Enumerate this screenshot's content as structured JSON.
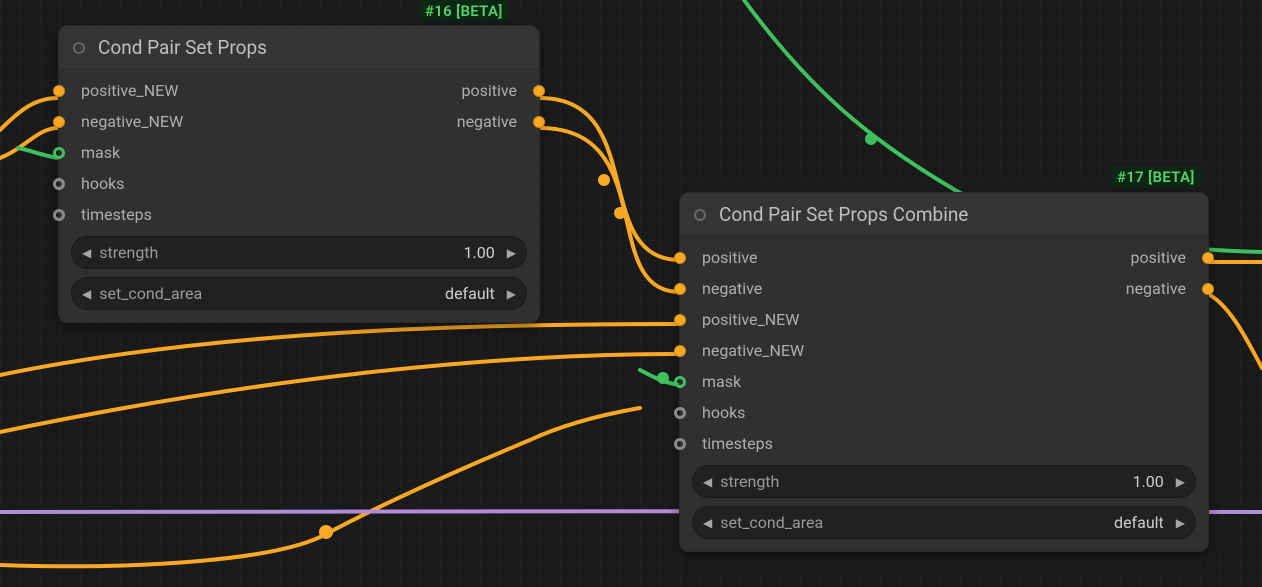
{
  "badges": {
    "badge16": "#16 [BETA]",
    "badge17": "#17 [BETA]"
  },
  "node1": {
    "title": "Cond Pair Set Props",
    "in_positive": "positive_NEW",
    "in_negative": "negative_NEW",
    "in_mask": "mask",
    "in_hooks": "hooks",
    "in_timesteps": "timesteps",
    "out_positive": "positive",
    "out_negative": "negative",
    "w_strength_label": "strength",
    "w_strength_value": "1.00",
    "w_area_label": "set_cond_area",
    "w_area_value": "default"
  },
  "node2": {
    "title": "Cond Pair Set Props Combine",
    "in_positive": "positive",
    "in_negative": "negative",
    "in_positive_new": "positive_NEW",
    "in_negative_new": "negative_NEW",
    "in_mask": "mask",
    "in_hooks": "hooks",
    "in_timesteps": "timesteps",
    "out_positive": "positive",
    "out_negative": "negative",
    "w_strength_label": "strength",
    "w_strength_value": "1.00",
    "w_area_label": "set_cond_area",
    "w_area_value": "default"
  },
  "arrows": {
    "left": "◀",
    "right": "▶"
  }
}
